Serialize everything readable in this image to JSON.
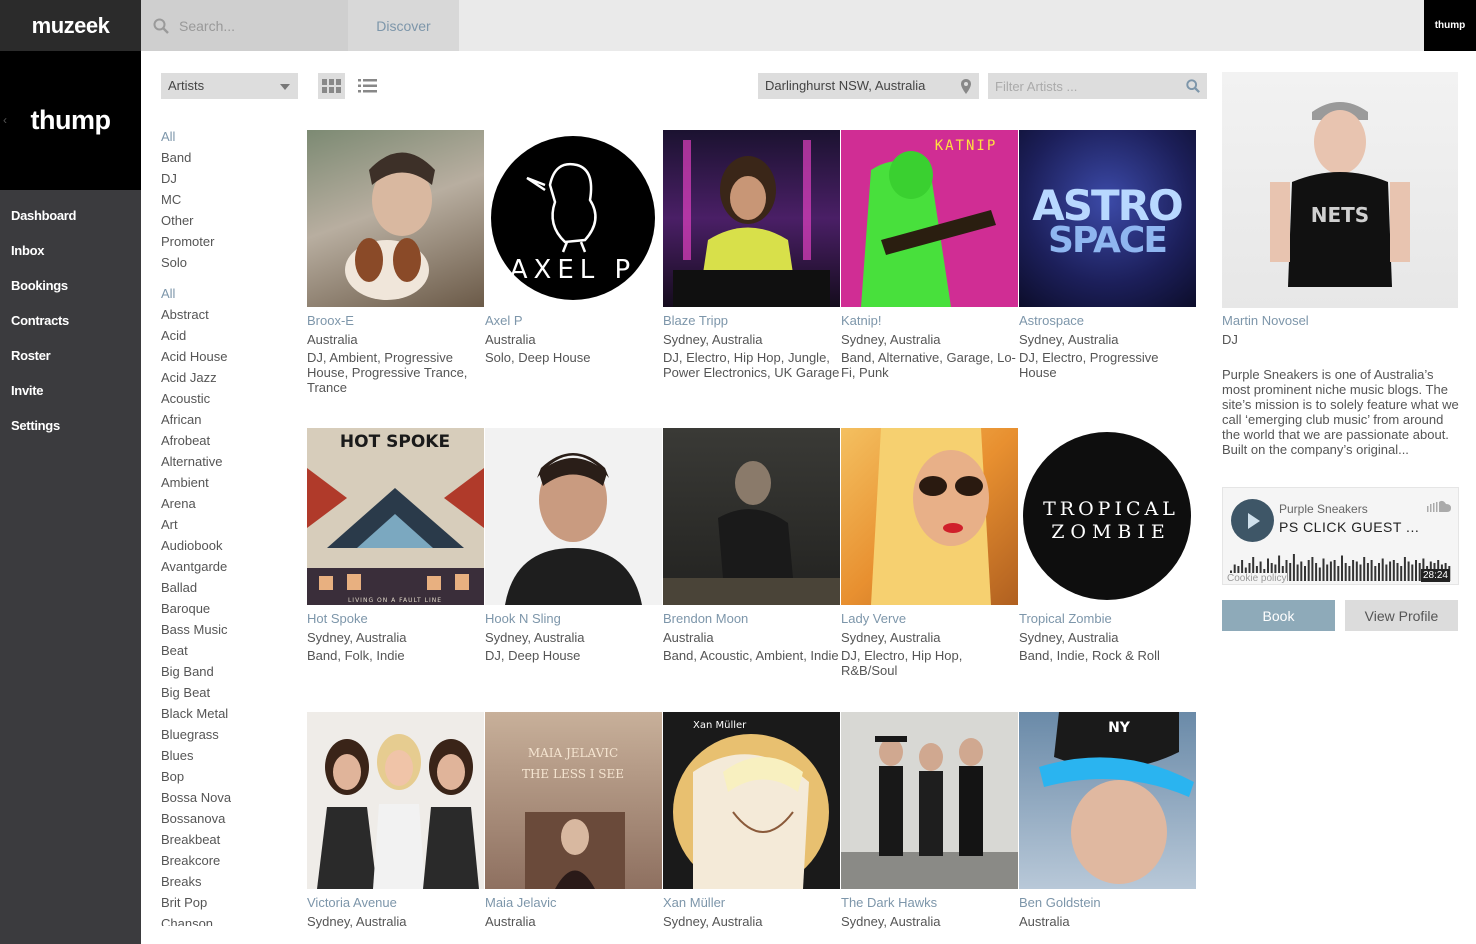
{
  "app": {
    "logo": "muzeek",
    "search_placeholder": "Search...",
    "discover_label": "Discover",
    "account_logo": "thump"
  },
  "sidebar": {
    "brand": "thump",
    "items": [
      {
        "label": "Dashboard"
      },
      {
        "label": "Inbox"
      },
      {
        "label": "Bookings"
      },
      {
        "label": "Contracts"
      },
      {
        "label": "Roster"
      },
      {
        "label": "Invite"
      },
      {
        "label": "Settings"
      }
    ]
  },
  "controls": {
    "category": "Artists",
    "location": "Darlinghurst NSW, Australia",
    "filter_placeholder": "Filter Artists ..."
  },
  "filters": {
    "types": [
      "All",
      "Band",
      "DJ",
      "MC",
      "Other",
      "Promoter",
      "Solo"
    ],
    "genres": [
      "All",
      "Abstract",
      "Acid",
      "Acid House",
      "Acid Jazz",
      "Acoustic",
      "African",
      "Afrobeat",
      "Alternative",
      "Ambient",
      "Arena",
      "Art",
      "Audiobook",
      "Avantgarde",
      "Ballad",
      "Baroque",
      "Bass Music",
      "Beat",
      "Big Band",
      "Big Beat",
      "Black Metal",
      "Bluegrass",
      "Blues",
      "Bop",
      "Bossa Nova",
      "Bossanova",
      "Breakbeat",
      "Breakcore",
      "Breaks",
      "Brit Pop",
      "Chanson"
    ]
  },
  "artists": [
    {
      "name": "Broox-E",
      "location": "Australia",
      "genres": "DJ, Ambient, Progressive House, Progressive Trance, Trance",
      "art": "photo-portrait-dog"
    },
    {
      "name": "Axel P",
      "location": "Australia",
      "genres": "Solo, Deep House",
      "art": "logo-axel-p"
    },
    {
      "name": "Blaze Tripp",
      "location": "Sydney, Australia",
      "genres": "DJ, Electro, Hip Hop, Jungle, Power Electronics, UK Garage",
      "art": "photo-dj-decks"
    },
    {
      "name": "Katnip!",
      "location": "Sydney, Australia",
      "genres": "Band, Alternative, Garage, Lo-Fi, Punk",
      "art": "photo-neon-guitar"
    },
    {
      "name": "Astrospace",
      "location": "Sydney, Australia",
      "genres": "DJ, Electro, Progressive House",
      "art": "logo-astro-space"
    },
    {
      "name": "Hot Spoke",
      "location": "Sydney, Australia",
      "genres": "Band, Folk, Indie",
      "art": "album-hot-spoke"
    },
    {
      "name": "Hook N Sling",
      "location": "Sydney, Australia",
      "genres": "DJ, Deep House",
      "art": "photo-portrait"
    },
    {
      "name": "Brendon Moon",
      "location": "Australia",
      "genres": "Band, Acoustic, Ambient, Indie",
      "art": "photo-dark-outdoor"
    },
    {
      "name": "Lady Verve",
      "location": "Sydney, Australia",
      "genres": "DJ, Electro, Hip Hop, R&B/Soul",
      "art": "photo-sunglasses"
    },
    {
      "name": "Tropical Zombie",
      "location": "Sydney, Australia",
      "genres": "Band, Indie, Rock & Roll",
      "art": "logo-tropical-zombie"
    },
    {
      "name": "Victoria Avenue",
      "location": "Sydney, Australia",
      "genres": "",
      "art": "photo-three-women"
    },
    {
      "name": "Maia Jelavic",
      "location": "Australia",
      "genres": "",
      "art": "album-maia-jelavic"
    },
    {
      "name": "Xan Müller",
      "location": "Sydney, Australia",
      "genres": "",
      "art": "illustration-face"
    },
    {
      "name": "The Dark Hawks",
      "location": "Sydney, Australia",
      "genres": "",
      "art": "photo-band-wall"
    },
    {
      "name": "Ben Goldstein",
      "location": "Australia",
      "genres": "",
      "art": "photo-cap"
    }
  ],
  "art_text": {
    "axel_p": "AXEL P",
    "katnip": "KATNIP",
    "astro": "ASTRO",
    "space": "SPACE",
    "hot_spoke": "HOT SPOKE",
    "hot_spoke_sub": "LIVING ON A FAULT LINE",
    "tropical": "TROPICAL",
    "zombie": "ZOMBIE",
    "maia_1": "MAIA JELAVIC",
    "maia_2": "THE LESS I SEE",
    "xan": "Xan Müller",
    "cap": "NY"
  },
  "profile": {
    "name": "Martin Novosel",
    "role": "DJ",
    "bio": "Purple Sneakers is one of Australia’s most prominent niche music blogs. The site’s mission is to solely feature what we call ‘emerging club music’ from around the world that we are passionate about. Built on the company’s original...",
    "shirt_text": "NETS",
    "player": {
      "artist": "Purple Sneakers",
      "track": "PS CLICK GUEST ...",
      "cookie": "Cookie policy",
      "duration": "28:24",
      "waveform": [
        0.35,
        0.55,
        0.5,
        0.7,
        0.45,
        0.6,
        0.8,
        0.5,
        0.65,
        0.4,
        0.75,
        0.6,
        0.55,
        0.85,
        0.5,
        0.7,
        0.6,
        0.9,
        0.55,
        0.65,
        0.5,
        0.7,
        0.8,
        0.6,
        0.45,
        0.75,
        0.55,
        0.65,
        0.7,
        0.5,
        0.85,
        0.6,
        0.5,
        0.7,
        0.65,
        0.55,
        0.8,
        0.6,
        0.7,
        0.5,
        0.6,
        0.75,
        0.55,
        0.65,
        0.7,
        0.6,
        0.5,
        0.8,
        0.65,
        0.55,
        0.7,
        0.6,
        0.75,
        0.5,
        0.65,
        0.6,
        0.7,
        0.55,
        0.6,
        0.5
      ]
    },
    "book_label": "Book",
    "view_label": "View Profile"
  }
}
